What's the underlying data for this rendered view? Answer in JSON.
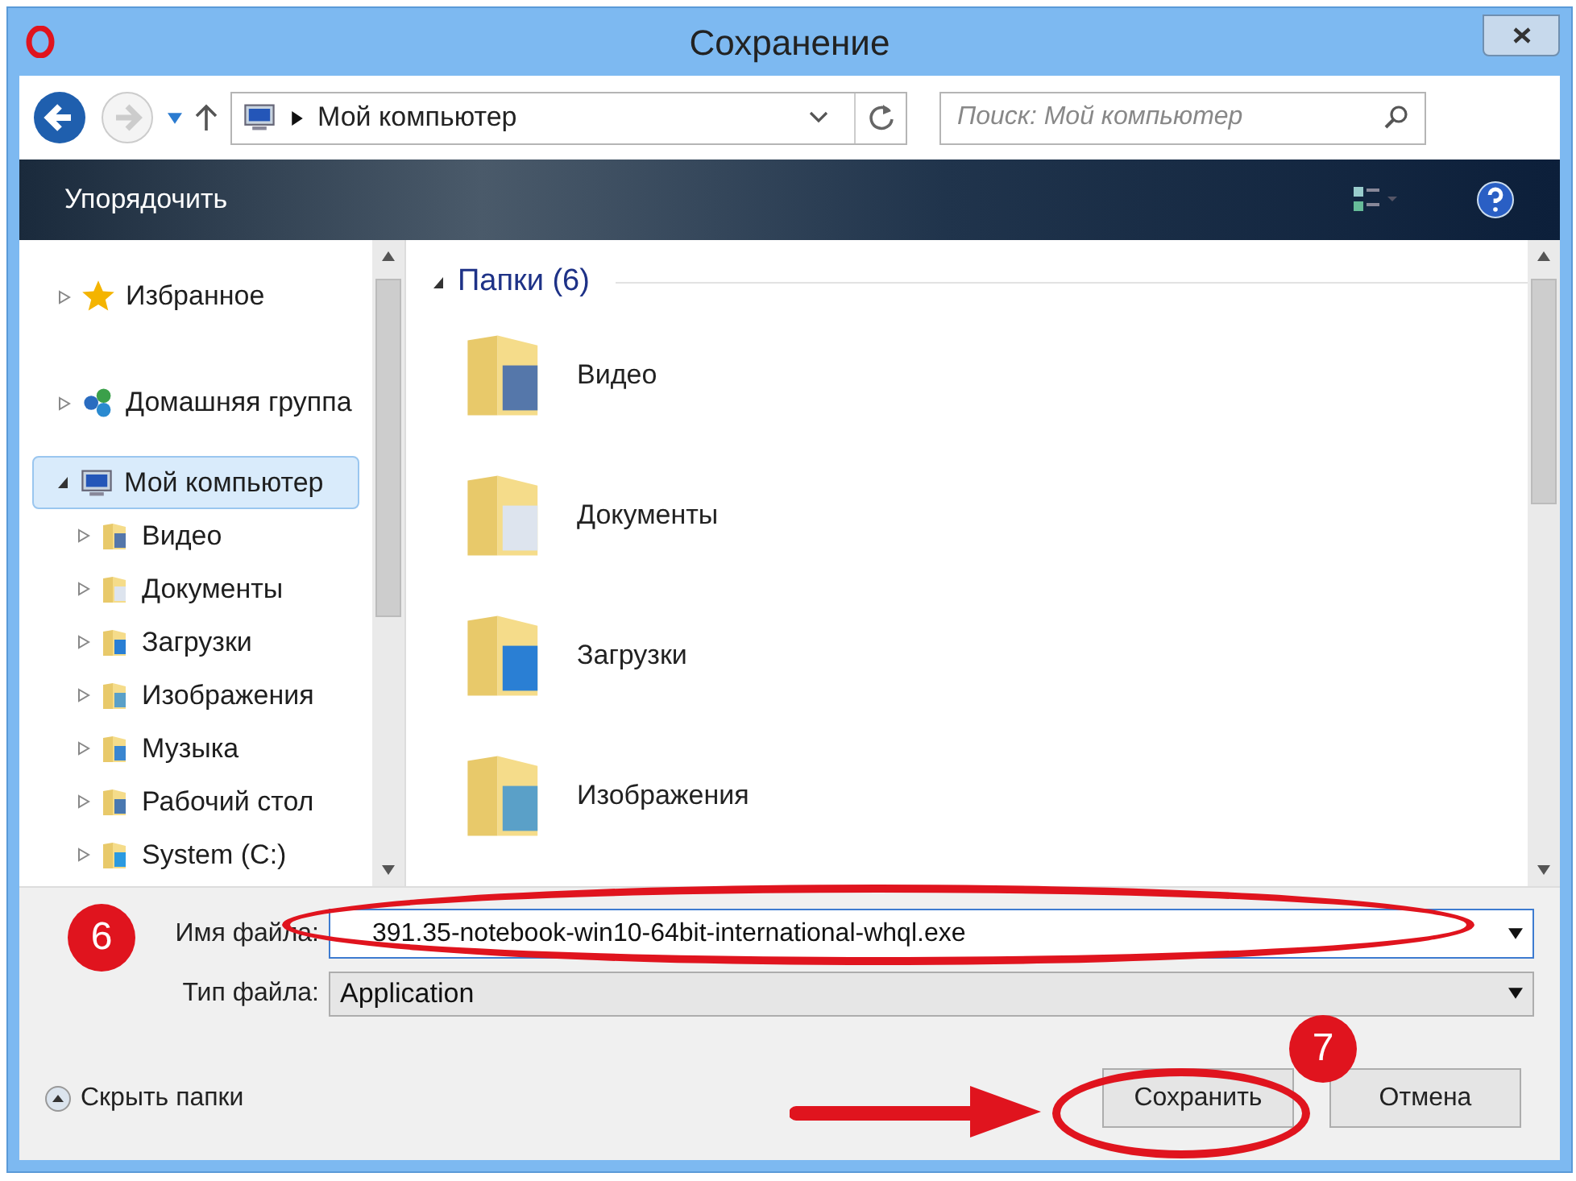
{
  "window": {
    "title": "Сохранение"
  },
  "address_bar": {
    "path": "Мой компьютер"
  },
  "search": {
    "placeholder": "Поиск: Мой компьютер"
  },
  "toolbar": {
    "organize": "Упорядочить"
  },
  "tree": [
    {
      "label": "Избранное",
      "expanded": false,
      "selected": false
    },
    {
      "label": "Домашняя группа",
      "expanded": false,
      "selected": false
    },
    {
      "label": "Мой компьютер",
      "expanded": true,
      "selected": true,
      "children": [
        {
          "label": "Видео",
          "expanded": false,
          "selected": false
        },
        {
          "label": "Документы",
          "expanded": false,
          "selected": false
        },
        {
          "label": "Загрузки",
          "expanded": false,
          "selected": false
        },
        {
          "label": "Изображения",
          "expanded": false,
          "selected": false
        },
        {
          "label": "Музыка",
          "expanded": false,
          "selected": false
        },
        {
          "label": "Рабочий стол",
          "expanded": false,
          "selected": false
        },
        {
          "label": "System (C:)",
          "expanded": false,
          "selected": false
        }
      ]
    }
  ],
  "content": {
    "group": {
      "label": "Папки (6)",
      "expanded": true
    },
    "items": [
      {
        "label": "Видео"
      },
      {
        "label": "Документы"
      },
      {
        "label": "Загрузки"
      },
      {
        "label": "Изображения"
      }
    ]
  },
  "form": {
    "filename_label": "Имя файла:",
    "filename": "391.35-notebook-win10-64bit-international-whql.exe",
    "filetype_label": "Тип файла:",
    "filetype": "Application"
  },
  "footer": {
    "hide_folders": "Скрыть папки",
    "save": "Сохранить",
    "cancel": "Отмена"
  },
  "annotations": [
    {
      "label": "6"
    },
    {
      "label": "7"
    }
  ]
}
